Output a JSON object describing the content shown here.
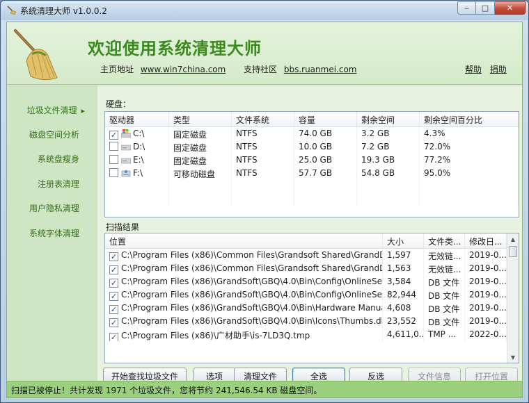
{
  "window": {
    "title": "系统清理大师 v1.0.0.2",
    "min": "‒",
    "max": "□",
    "close": "✕"
  },
  "header": {
    "welcome": "欢迎使用系统清理大师",
    "homepage_label": "主页地址",
    "homepage_url": "www.win7china.com",
    "community_label": "支持社区",
    "community_url": "bbs.ruanmei.com",
    "help": "帮助",
    "donate": "捐助"
  },
  "sidebar": {
    "items": [
      {
        "label": "垃圾文件清理",
        "active": true
      },
      {
        "label": "磁盘空间分析"
      },
      {
        "label": "系统盘瘦身"
      },
      {
        "label": "注册表清理"
      },
      {
        "label": "用户隐私清理"
      },
      {
        "label": "系统字体清理"
      }
    ],
    "active_marker": "▸"
  },
  "drives": {
    "section_label": "硬盘：",
    "columns": [
      "驱动器",
      "类型",
      "文件系统",
      "容量",
      "剩余空间",
      "剩余空间百分比"
    ],
    "rows": [
      {
        "checked": true,
        "drive": "C:\\",
        "type": "固定磁盘",
        "fs": "NTFS",
        "capacity": "74.0 GB",
        "free": "3.2 GB",
        "pct": "4.3%"
      },
      {
        "checked": false,
        "drive": "D:\\",
        "type": "固定磁盘",
        "fs": "NTFS",
        "capacity": "10.0 GB",
        "free": "7.2 GB",
        "pct": "72.0%"
      },
      {
        "checked": false,
        "drive": "E:\\",
        "type": "固定磁盘",
        "fs": "NTFS",
        "capacity": "25.0 GB",
        "free": "19.3 GB",
        "pct": "77.2%"
      },
      {
        "checked": false,
        "drive": "F:\\",
        "type": "可移动磁盘",
        "fs": "NTFS",
        "capacity": "57.7 GB",
        "free": "54.8 GB",
        "pct": "95.0%"
      }
    ]
  },
  "results": {
    "section_label": "扫描结果",
    "columns": [
      "位置",
      "大小",
      "文件类...",
      "修改日..."
    ],
    "rows": [
      {
        "checked": true,
        "path": "C:\\Program Files (x86)\\Common Files\\Grandsoft Shared\\GrandDog\\L...",
        "size": "1,597",
        "type": "无效链...",
        "date": "2019-0..."
      },
      {
        "checked": true,
        "path": "C:\\Program Files (x86)\\Common Files\\Grandsoft Shared\\GrandDog\\L...",
        "size": "1,563",
        "type": "无效链...",
        "date": "2019-0..."
      },
      {
        "checked": true,
        "path": "C:\\Program Files (x86)\\GrandSoft\\GBQ\\4.0\\Bin\\Config\\OnlineService...",
        "size": "3,584",
        "type": "DB 文件",
        "date": "2019-0..."
      },
      {
        "checked": true,
        "path": "C:\\Program Files (x86)\\GrandSoft\\GBQ\\4.0\\Bin\\Config\\OnlineService...",
        "size": "82,944",
        "type": "DB 文件",
        "date": "2019-0..."
      },
      {
        "checked": true,
        "path": "C:\\Program Files (x86)\\GrandSoft\\GBQ\\4.0\\Bin\\Hardware Manual\\Th...",
        "size": "4,608",
        "type": "DB 文件",
        "date": "2019-0..."
      },
      {
        "checked": true,
        "path": "C:\\Program Files (x86)\\GrandSoft\\GBQ\\4.0\\Bin\\Icons\\Thumbs.db",
        "size": "23,552",
        "type": "DB 文件",
        "date": "2019-0..."
      },
      {
        "checked": true,
        "path": "C:\\Program Files (x86)\\广材助手\\is-7LD3Q.tmp",
        "size": "4,611,0...",
        "type": "TMP ...",
        "date": "2022-0..."
      }
    ]
  },
  "buttons": {
    "start_scan": "开始查找垃圾文件",
    "options": "选项",
    "clean": "清理文件",
    "select_all": "全选",
    "invert": "反选",
    "file_info": "文件信息",
    "open_location": "打开位置"
  },
  "status": "扫描已被停止！共计发现 1971 个垃圾文件，您将节约 241,546.54 KB 磁盘空间。",
  "colors": {
    "accent_green": "#3a8a1e",
    "sidebar_text": "#3a6b1a",
    "status_bg": "#9bd07f"
  },
  "icons": {
    "app": "broom-icon",
    "drive_system": "windows-drive-icon",
    "drive_fixed": "hard-drive-icon",
    "drive_removable": "removable-drive-icon"
  }
}
